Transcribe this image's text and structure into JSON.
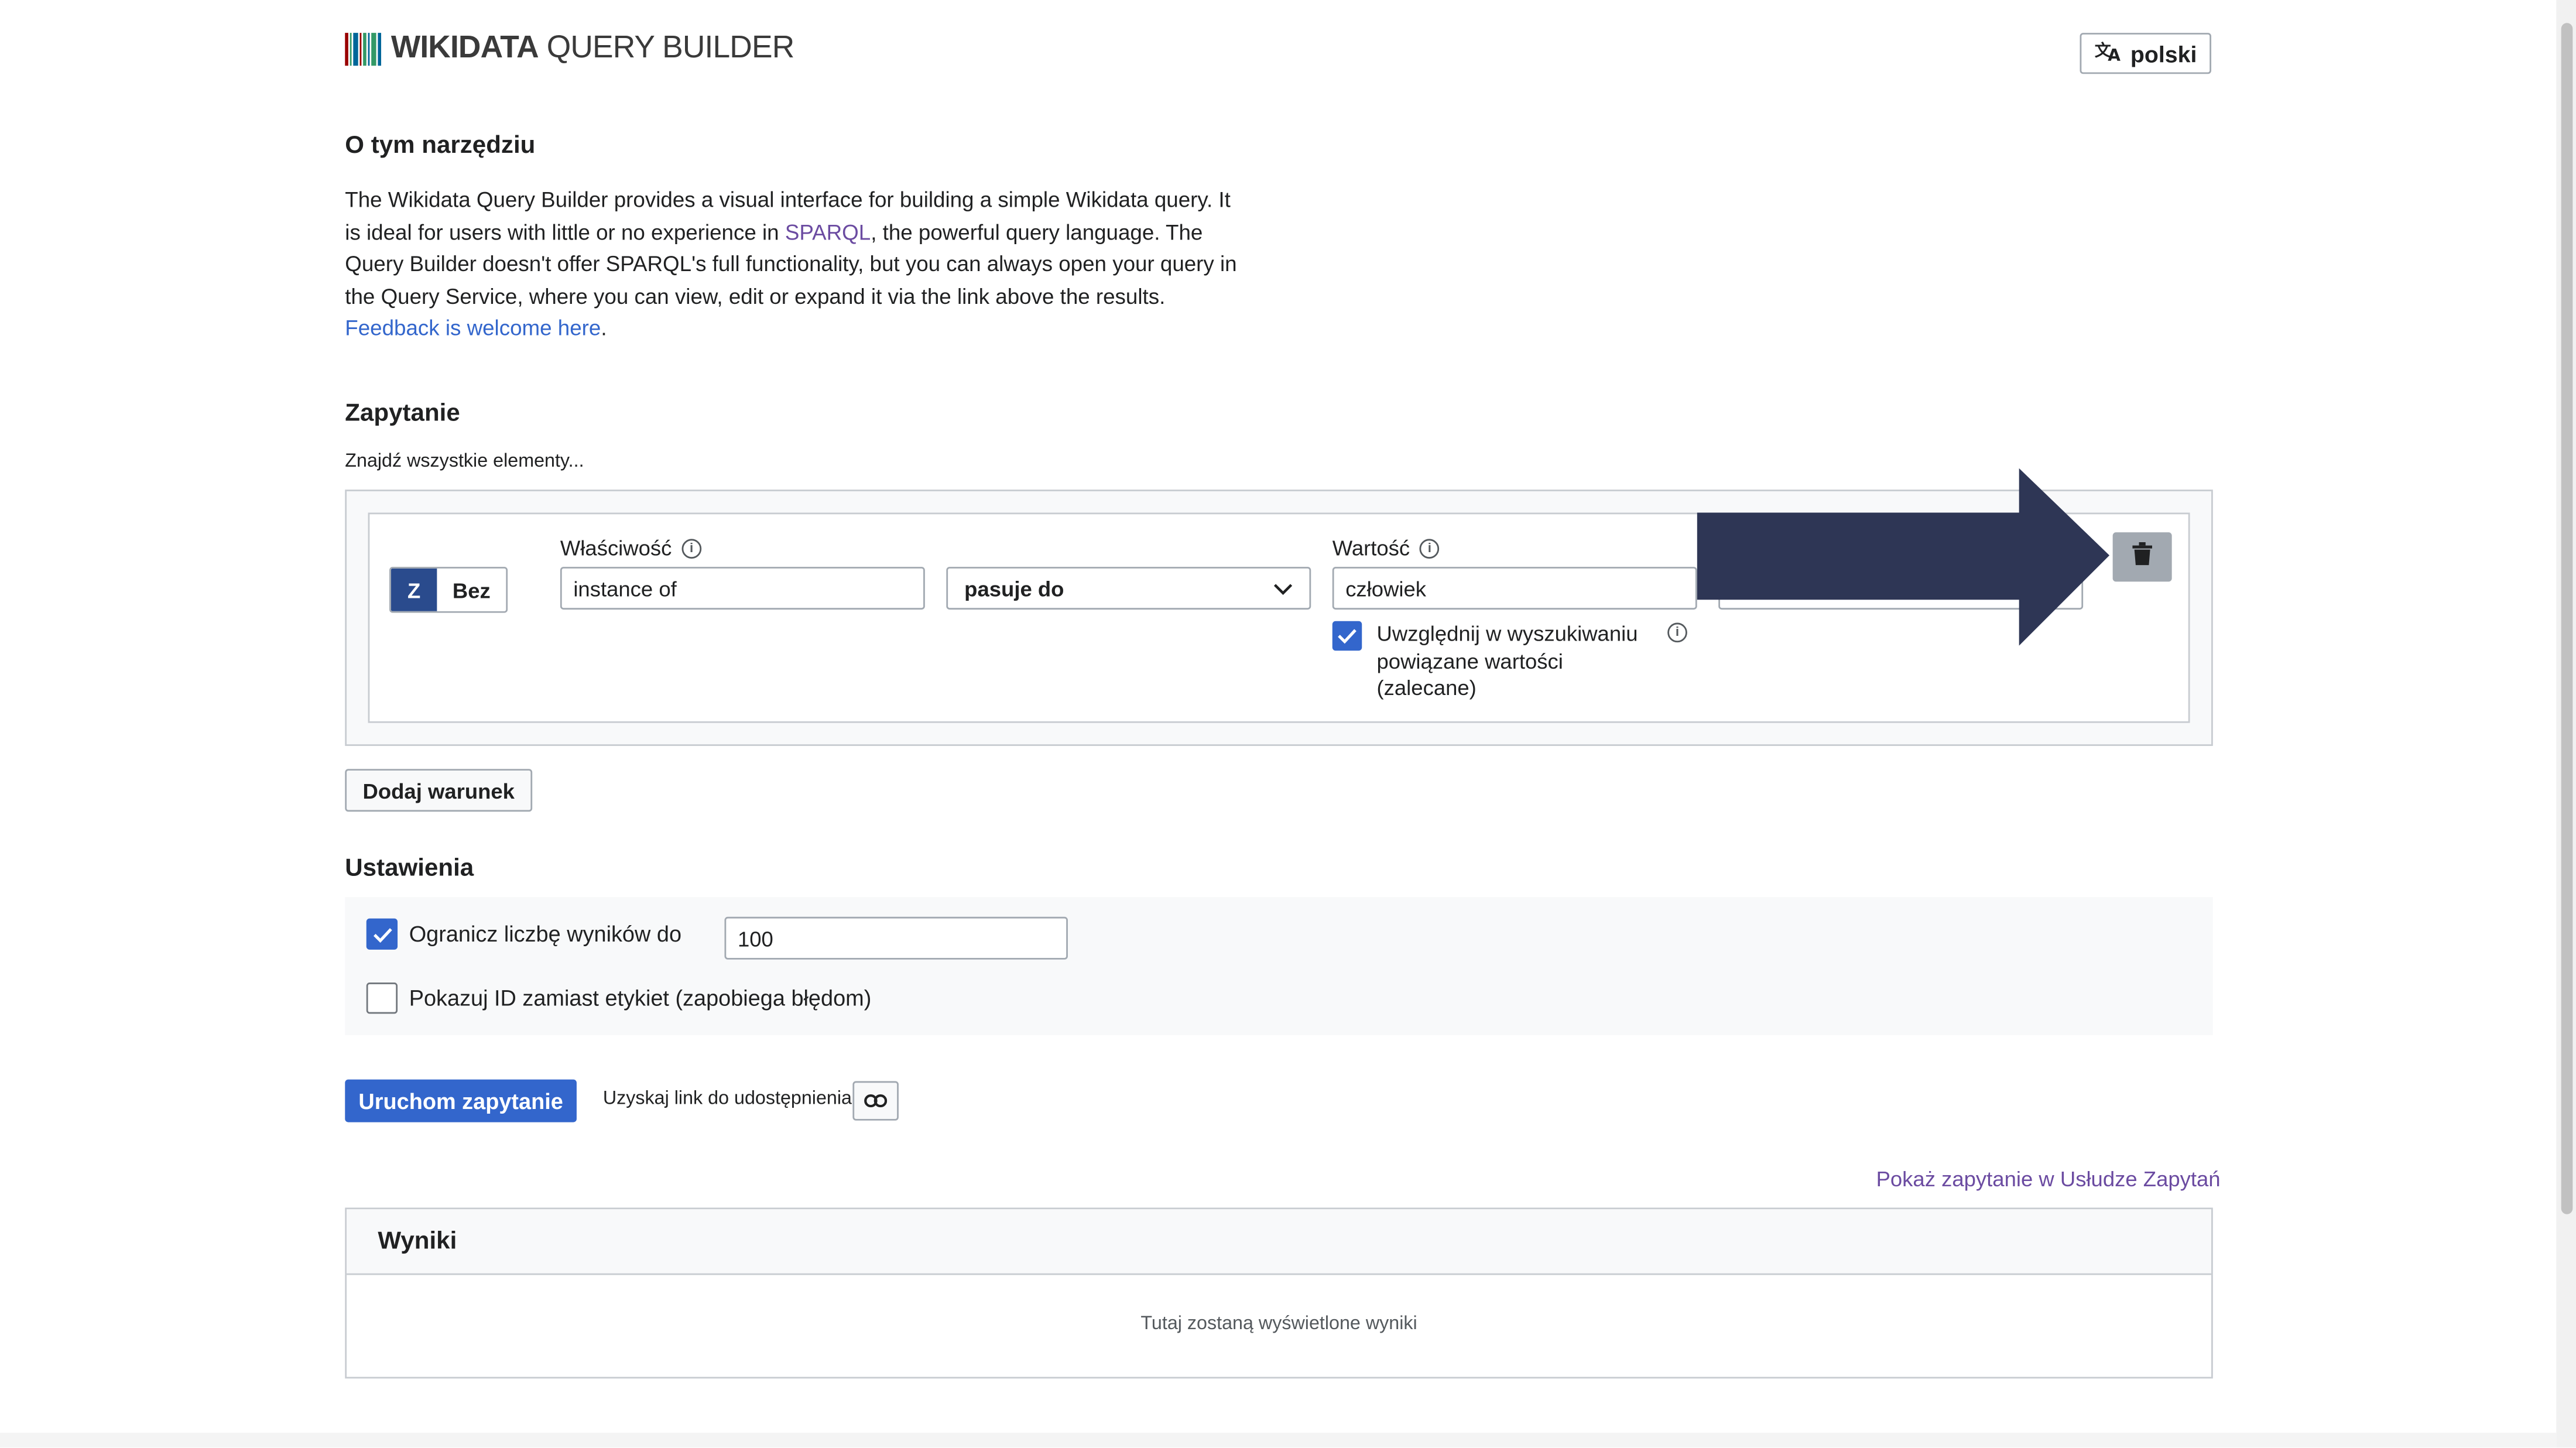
{
  "header": {
    "logo_bold": "WIKIDATA",
    "logo_light": " QUERY BUILDER",
    "barcode_colors": [
      "#990000",
      "#339966",
      "#006699",
      "#990000",
      "#339966",
      "#006699",
      "#339966",
      "#006699"
    ],
    "language_button": "polski",
    "language_icon": "translate-icon"
  },
  "about": {
    "title": "O tym narzędziu",
    "text_1": "The Wikidata Query Builder provides a visual interface for building a simple Wikidata query. It is ideal for users with little or no experience in ",
    "sparql_link": "SPARQL",
    "text_2": ", the powerful query language. The Query Builder doesn't offer SPARQL's full functionality, but you can always open your query in the Query Service, where you can view, edit or expand it via the link above the results.",
    "feedback_link": "Feedback is welcome here",
    "feedback_tail": "."
  },
  "query": {
    "title": "Zapytanie",
    "find_all": "Znajdź wszystkie elementy...",
    "toggle_with": "Z",
    "toggle_without": "Bez",
    "property_label": "Właściwość",
    "property_value": "instance of",
    "relation_value": "pasuje do",
    "value_label": "Wartość",
    "value_value": "człowiek",
    "subclasses_label": "Uwzględnij w wyszukiwaniu powiązane wartości (zalecane)",
    "subclasses_checked": true,
    "add_condition": "Dodaj warunek",
    "arrow_color": "#2e3655",
    "delete_icon": "trash-icon"
  },
  "settings": {
    "title": "Ustawienia",
    "limit_label": "Ogranicz liczbę wyników do",
    "limit_checked": true,
    "limit_value": "100",
    "ids_label": "Pokazuj ID zamiast etykiet (zapobiega błędom)",
    "ids_checked": false
  },
  "actions": {
    "run_query": "Uruchom zapytanie",
    "share_text": "Uzyskaj link do udostępnienia",
    "share_icon": "link-icon"
  },
  "results": {
    "wqs_link": "Pokaż zapytanie w Usłudze Zapytań",
    "title": "Wyniki",
    "placeholder": "Tutaj zostaną wyświetlone wyniki"
  },
  "colors": {
    "accent": "#3366cc",
    "toggle_active": "#2a4b8d",
    "visited_link": "#6b4ba1"
  }
}
